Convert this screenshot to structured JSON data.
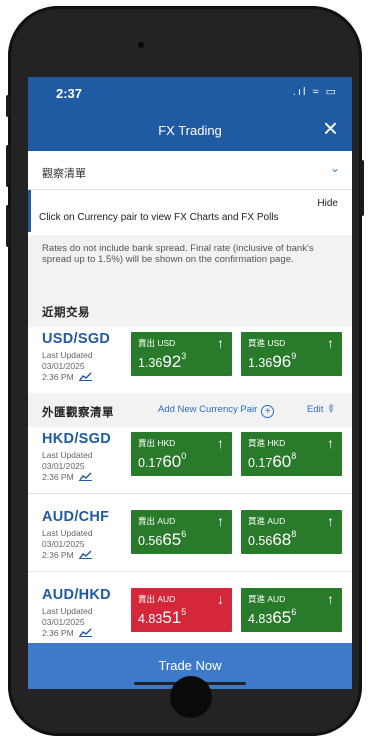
{
  "status": {
    "time": "2:37",
    "icons": ".ıl ≈ ▭"
  },
  "nav": {
    "title": "FX Trading",
    "close_icon": "×"
  },
  "watchlist_select": {
    "label": "觀察清單",
    "chevron": "⌄"
  },
  "info": {
    "hide": "Hide",
    "text": "Click on Currency pair to view FX Charts and FX Polls"
  },
  "note": {
    "text": "Rates do not include bank spread. Final rate (inclusive of bank's spread up to 1.5%) will be shown on the confirmation page."
  },
  "recent": {
    "title": "近期交易"
  },
  "watch": {
    "title": "外匯觀察清單",
    "add": "Add New Currency Pair",
    "plus": "+",
    "edit": "Edit",
    "pencil": "✎"
  },
  "pairs": [
    {
      "pair": "USD/SGD",
      "lu1": "Last Updated",
      "lu2": "03/01/2025",
      "lu3": "2:36 PM",
      "sell": {
        "label": "賣出 USD",
        "arrow": "↑",
        "base": "1.36",
        "big": "92",
        "sup": "3",
        "color": "#2a7a2c"
      },
      "buy": {
        "label": "買進 USD",
        "arrow": "↑",
        "base": "1.36",
        "big": "96",
        "sup": "9",
        "color": "#2a7a2c"
      }
    },
    {
      "pair": "HKD/SGD",
      "lu1": "Last Updated",
      "lu2": "03/01/2025",
      "lu3": "2:36 PM",
      "sell": {
        "label": "賣出 HKD",
        "arrow": "↑",
        "base": "0.17",
        "big": "60",
        "sup": "0",
        "color": "#2a7a2c"
      },
      "buy": {
        "label": "買進 HKD",
        "arrow": "↑",
        "base": "0.17",
        "big": "60",
        "sup": "8",
        "color": "#2a7a2c"
      }
    },
    {
      "pair": "AUD/CHF",
      "lu1": "Last Updated",
      "lu2": "03/01/2025",
      "lu3": "2:36 PM",
      "sell": {
        "label": "賣出 AUD",
        "arrow": "↑",
        "base": "0.56",
        "big": "65",
        "sup": "6",
        "color": "#2a7a2c"
      },
      "buy": {
        "label": "買進 AUD",
        "arrow": "↑",
        "base": "0.56",
        "big": "68",
        "sup": "8",
        "color": "#2a7a2c"
      }
    },
    {
      "pair": "AUD/HKD",
      "lu1": "Last Updated",
      "lu2": "03/01/2025",
      "lu3": "2:36 PM",
      "sell": {
        "label": "賣出 AUD",
        "arrow": "↓",
        "base": "4.83",
        "big": "51",
        "sup": "5",
        "color": "#d4283a"
      },
      "buy": {
        "label": "買進 AUD",
        "arrow": "↑",
        "base": "4.83",
        "big": "65",
        "sup": "6",
        "color": "#2a7a2c"
      }
    }
  ],
  "trade": {
    "label": "Trade Now"
  },
  "icons": {
    "close": "close-icon",
    "chevron": "chevron-down-icon",
    "plus": "plus-circle-icon",
    "edit": "pencil-icon",
    "chart": "line-chart-icon",
    "arrow_up": "arrow-up-icon",
    "arrow_down": "arrow-down-icon"
  }
}
